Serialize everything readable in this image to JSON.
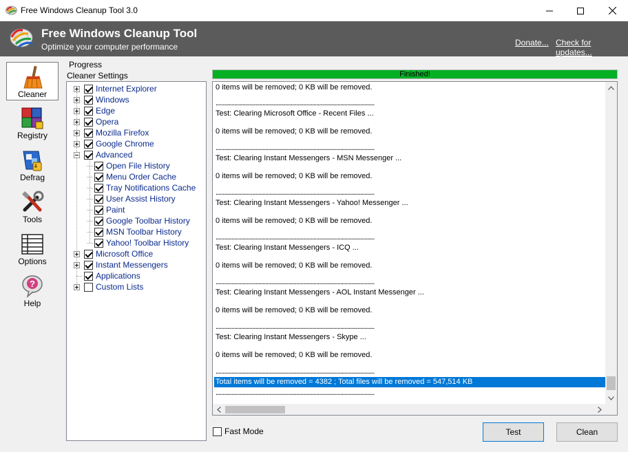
{
  "window": {
    "title": "Free Windows Cleanup Tool 3.0",
    "minimize_symbol": "—",
    "maximize_symbol": "☐",
    "close_symbol": "✕"
  },
  "banner": {
    "title": "Free Windows Cleanup Tool",
    "subtitle": "Optimize your computer performance",
    "donate_link": "Donate...",
    "updates_link": "Check for updates..."
  },
  "sidebar": {
    "items": [
      {
        "label": "Cleaner",
        "icon": "broom-icon",
        "active": true
      },
      {
        "label": "Registry",
        "icon": "registry-cubes-icon",
        "active": false
      },
      {
        "label": "Defrag",
        "icon": "defrag-drive-icon",
        "active": false
      },
      {
        "label": "Tools",
        "icon": "tools-icon",
        "active": false
      },
      {
        "label": "Options",
        "icon": "options-list-icon",
        "active": false
      },
      {
        "label": "Help",
        "icon": "help-bubble-icon",
        "active": false
      }
    ]
  },
  "labels": {
    "progress": "Progress",
    "cleaner_settings": "Cleaner Settings"
  },
  "tree": {
    "items": [
      {
        "label": "Internet Explorer",
        "checked": true,
        "expander": "plus",
        "level": 0
      },
      {
        "label": "Windows",
        "checked": true,
        "expander": "plus",
        "level": 0
      },
      {
        "label": "Edge",
        "checked": true,
        "expander": "plus",
        "level": 0
      },
      {
        "label": "Opera",
        "checked": true,
        "expander": "plus",
        "level": 0
      },
      {
        "label": "Mozilla Firefox",
        "checked": true,
        "expander": "plus",
        "level": 0
      },
      {
        "label": "Google Chrome",
        "checked": true,
        "expander": "plus",
        "level": 0
      },
      {
        "label": "Advanced",
        "checked": true,
        "expander": "minus",
        "level": 0
      },
      {
        "label": "Open File History",
        "checked": true,
        "expander": "none",
        "level": 1
      },
      {
        "label": "Menu Order Cache",
        "checked": true,
        "expander": "none",
        "level": 1
      },
      {
        "label": "Tray Notifications Cache",
        "checked": true,
        "expander": "none",
        "level": 1
      },
      {
        "label": "User Assist History",
        "checked": true,
        "expander": "none",
        "level": 1
      },
      {
        "label": "Paint",
        "checked": true,
        "expander": "none",
        "level": 1
      },
      {
        "label": "Google Toolbar History",
        "checked": true,
        "expander": "none",
        "level": 1
      },
      {
        "label": "MSN Toolbar History",
        "checked": true,
        "expander": "none",
        "level": 1
      },
      {
        "label": "Yahoo! Toolbar History",
        "checked": true,
        "expander": "none",
        "level": 1
      },
      {
        "label": "Microsoft Office",
        "checked": true,
        "expander": "plus",
        "level": 0
      },
      {
        "label": "Instant Messengers",
        "checked": true,
        "expander": "plus",
        "level": 0
      },
      {
        "label": "Applications",
        "checked": true,
        "expander": "none",
        "level": 0
      },
      {
        "label": "Custom Lists",
        "checked": false,
        "expander": "plus",
        "level": 0
      }
    ]
  },
  "progress": {
    "value_percent": 100,
    "text": "Finished!",
    "color": "#06b025"
  },
  "log": {
    "lines": [
      {
        "text": "0 items will be removed; 0 KB will be removed.",
        "type": "text"
      },
      {
        "text": "................................................................................................................",
        "type": "sep"
      },
      {
        "text": "Test: Clearing Microsoft Office - Recent Files ...",
        "type": "text"
      },
      {
        "text": "0 items will be removed; 0 KB will be removed.",
        "type": "text"
      },
      {
        "text": "................................................................................................................",
        "type": "sep"
      },
      {
        "text": "Test: Clearing Instant Messengers - MSN Messenger ...",
        "type": "text"
      },
      {
        "text": "0 items will be removed; 0 KB will be removed.",
        "type": "text"
      },
      {
        "text": "................................................................................................................",
        "type": "sep"
      },
      {
        "text": "Test: Clearing Instant Messengers - Yahoo! Messenger ...",
        "type": "text"
      },
      {
        "text": "0 items will be removed; 0 KB will be removed.",
        "type": "text"
      },
      {
        "text": "................................................................................................................",
        "type": "sep"
      },
      {
        "text": "Test: Clearing Instant Messengers - ICQ ...",
        "type": "text"
      },
      {
        "text": "0 items will be removed; 0 KB will be removed.",
        "type": "text"
      },
      {
        "text": "................................................................................................................",
        "type": "sep"
      },
      {
        "text": "Test: Clearing Instant Messengers - AOL Instant Messenger ...",
        "type": "text"
      },
      {
        "text": "0 items will be removed; 0 KB will be removed.",
        "type": "text"
      },
      {
        "text": "................................................................................................................",
        "type": "sep"
      },
      {
        "text": "Test: Clearing Instant Messengers - Skype ...",
        "type": "text"
      },
      {
        "text": "0 items will be removed; 0 KB will be removed.",
        "type": "text"
      },
      {
        "text": "................................................................................................................",
        "type": "sep"
      },
      {
        "text": "Total items will be removed = 4382 ; Total files will be removed = 547,514 KB",
        "type": "highlight"
      },
      {
        "text": "................................................................................................................",
        "type": "sep"
      }
    ],
    "highlight_color": "#0078d7"
  },
  "fast_mode": {
    "label": "Fast Mode",
    "checked": false
  },
  "buttons": {
    "test": "Test",
    "clean": "Clean"
  }
}
